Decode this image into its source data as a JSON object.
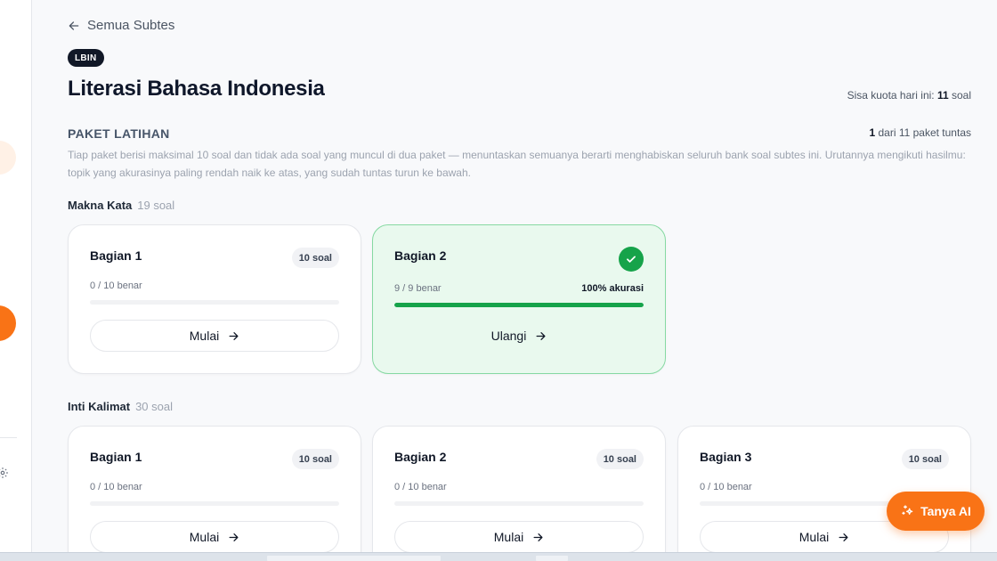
{
  "nav": {
    "back_label": "Semua Subtes"
  },
  "subtest": {
    "code": "LBIN",
    "title": "Literasi Bahasa Indonesia",
    "quota_prefix": "Sisa kuota hari ini: ",
    "quota_value": "11",
    "quota_suffix": " soal"
  },
  "practice": {
    "heading": "PAKET LATIHAN",
    "completed_value": "1",
    "completed_suffix": " dari 11 paket tuntas",
    "description": "Tiap paket berisi maksimal 10 soal dan tidak ada soal yang muncul di dua paket — menuntaskan semuanya berarti menghabiskan seluruh bank soal subtes ini. Urutannya mengikuti hasilmu: topik yang akurasinya paling rendah naik ke atas, yang sudah tuntas turun ke bawah."
  },
  "groups": [
    {
      "name": "Makna Kata",
      "count": "19 soal",
      "packs": [
        {
          "title": "Bagian 1",
          "chip": "10 soal",
          "progress": "0 / 10 benar",
          "fraction": 0,
          "button": "Mulai",
          "done": false
        },
        {
          "title": "Bagian 2",
          "progress": "9 / 9 benar",
          "accuracy": "100% akurasi",
          "fraction": 1.0,
          "button": "Ulangi",
          "done": true
        }
      ]
    },
    {
      "name": "Inti Kalimat",
      "count": "30 soal",
      "packs": [
        {
          "title": "Bagian 1",
          "chip": "10 soal",
          "progress": "0 / 10 benar",
          "fraction": 0,
          "button": "Mulai",
          "done": false
        },
        {
          "title": "Bagian 2",
          "chip": "10 soal",
          "progress": "0 / 10 benar",
          "fraction": 0,
          "button": "Mulai",
          "done": false
        },
        {
          "title": "Bagian 3",
          "chip": "10 soal",
          "progress": "0 / 10 benar",
          "fraction": 0,
          "button": "Mulai",
          "done": false
        }
      ]
    }
  ],
  "assistant": {
    "label": "Tanya AI"
  },
  "colors": {
    "accent": "#f97316",
    "success": "#16a34a",
    "done_bg": "#e9f9ee"
  }
}
